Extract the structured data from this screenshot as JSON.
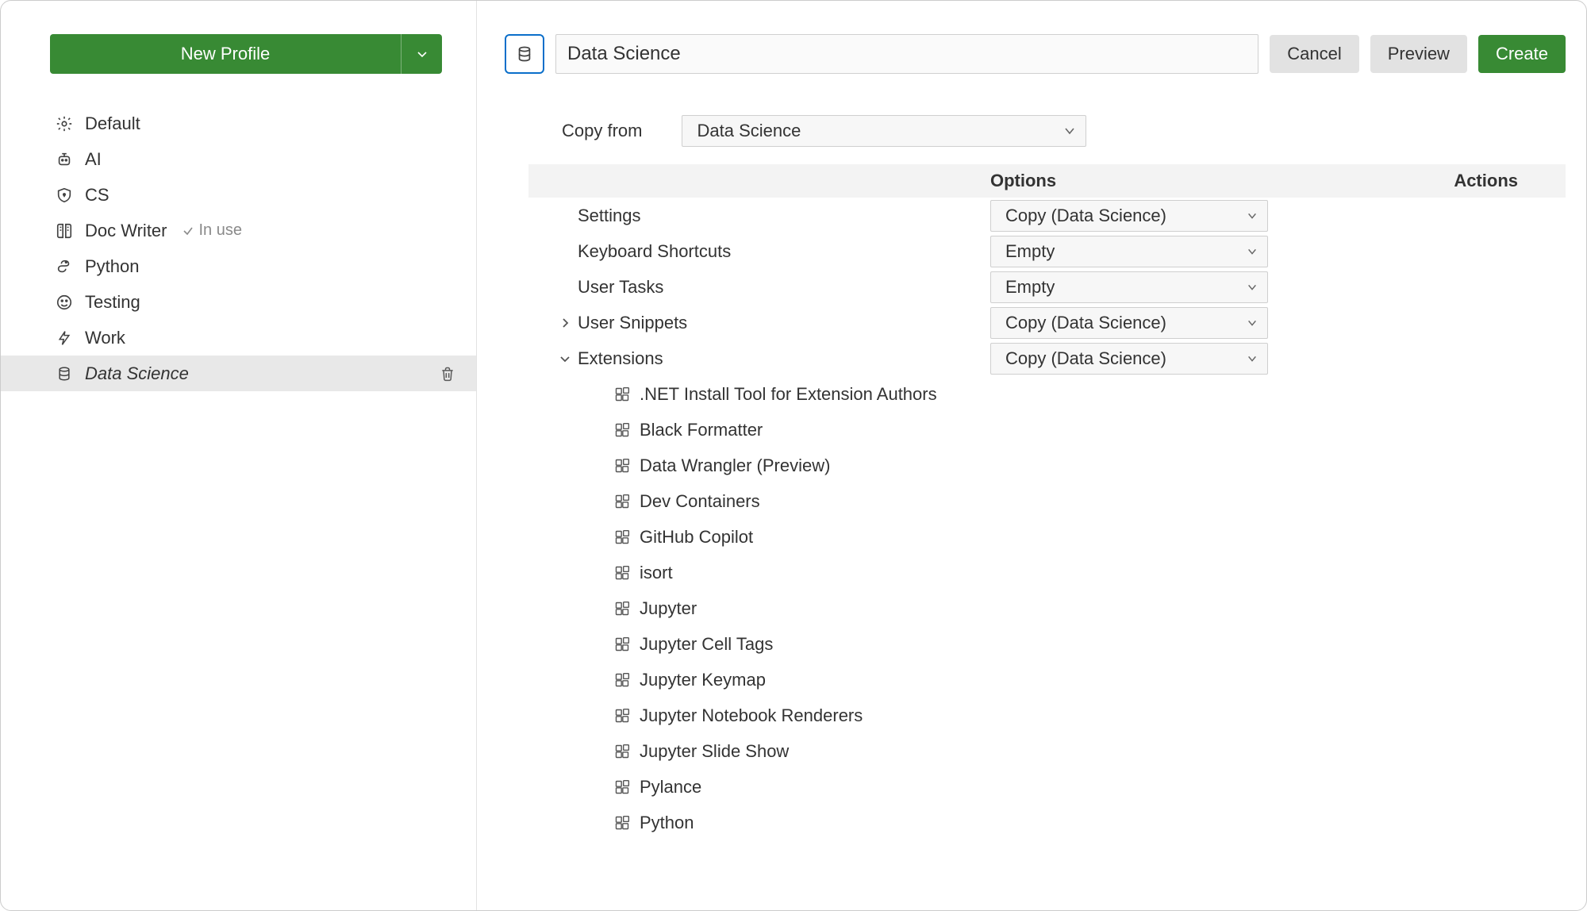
{
  "sidebar": {
    "newProfile": {
      "label": "New Profile"
    },
    "items": [
      {
        "icon": "gear",
        "label": "Default"
      },
      {
        "icon": "robot",
        "label": "AI"
      },
      {
        "icon": "shield",
        "label": "CS"
      },
      {
        "icon": "book",
        "label": "Doc Writer",
        "inUse": true,
        "inUseLabel": "In use"
      },
      {
        "icon": "snake",
        "label": "Python"
      },
      {
        "icon": "smiley",
        "label": "Testing"
      },
      {
        "icon": "bolt",
        "label": "Work"
      },
      {
        "icon": "database",
        "label": "Data Science",
        "selected": true
      }
    ]
  },
  "header": {
    "nameValue": "Data Science",
    "cancel": "Cancel",
    "preview": "Preview",
    "create": "Create"
  },
  "copyFrom": {
    "label": "Copy from",
    "value": "Data Science"
  },
  "columns": {
    "options": "Options",
    "actions": "Actions"
  },
  "rows": [
    {
      "label": "Settings",
      "option": "Copy (Data Science)",
      "expander": "none"
    },
    {
      "label": "Keyboard Shortcuts",
      "option": "Empty",
      "expander": "none"
    },
    {
      "label": "User Tasks",
      "option": "Empty",
      "expander": "none"
    },
    {
      "label": "User Snippets",
      "option": "Copy (Data Science)",
      "expander": "collapsed"
    },
    {
      "label": "Extensions",
      "option": "Copy (Data Science)",
      "expander": "expanded"
    }
  ],
  "extensions": [
    ".NET Install Tool for Extension Authors",
    "Black Formatter",
    "Data Wrangler (Preview)",
    "Dev Containers",
    "GitHub Copilot",
    "isort",
    "Jupyter",
    "Jupyter Cell Tags",
    "Jupyter Keymap",
    "Jupyter Notebook Renderers",
    "Jupyter Slide Show",
    "Pylance",
    "Python"
  ]
}
